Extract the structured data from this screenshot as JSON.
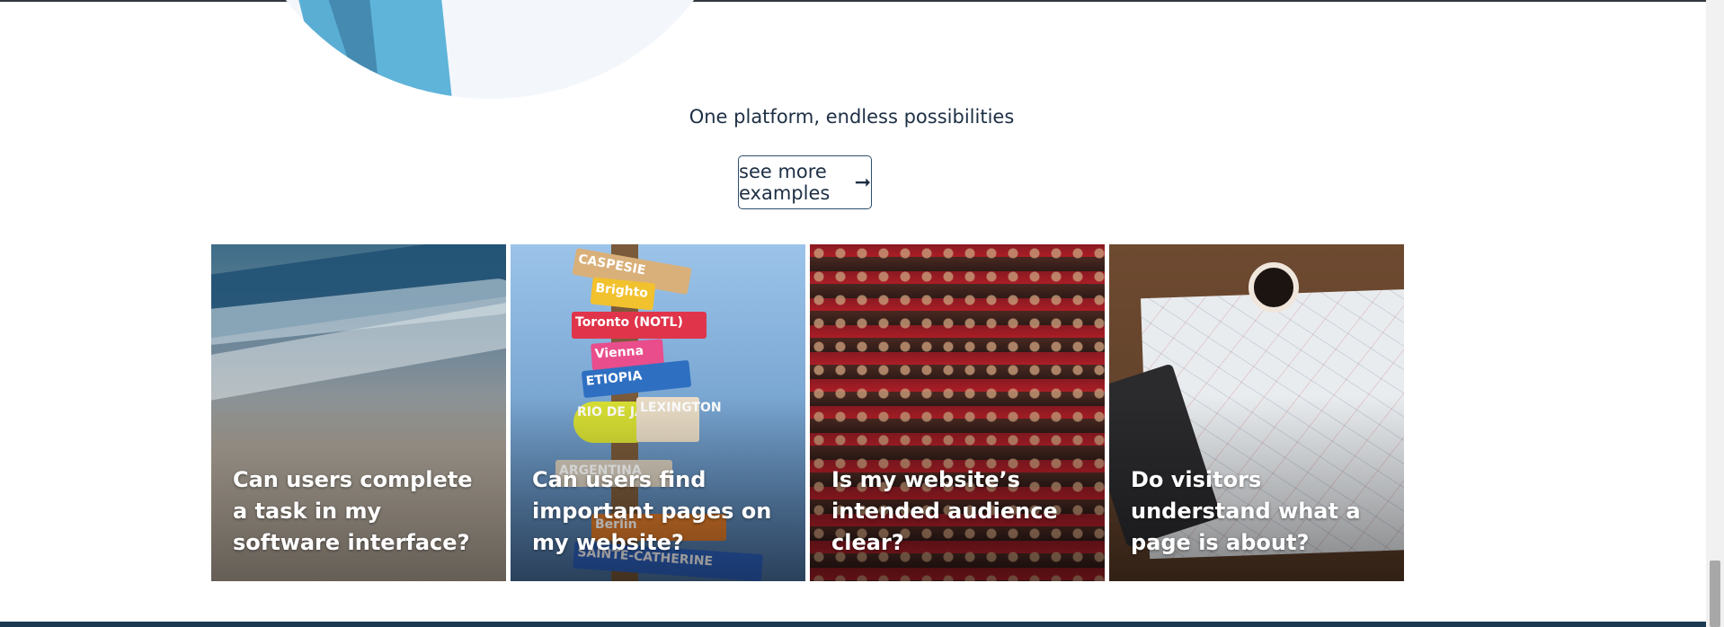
{
  "tagline": "One platform, endless possibilities",
  "more_button": {
    "label": "see more examples",
    "icon": "arrow-right-icon"
  },
  "cards": [
    {
      "title": "Can users complete a task in my software interface?"
    },
    {
      "title": "Can users find important pages on my website?"
    },
    {
      "title": "Is my website’s intended audience clear?"
    },
    {
      "title": "Do visitors understand what a page is about?"
    }
  ],
  "sign_labels": [
    "CASPESIE",
    "Brighto",
    "Toronto (NOTL)",
    "Vienna",
    "ETIOPIA",
    "RIO DE JANEIRO",
    "LEXINGTON",
    "ARGENTINA",
    "Berlin",
    "SAINTE-CATHERINE"
  ],
  "colors": {
    "text_dark": "#1d2f45",
    "button_border": "#2d4d6c",
    "footer": "#1b3a52"
  }
}
